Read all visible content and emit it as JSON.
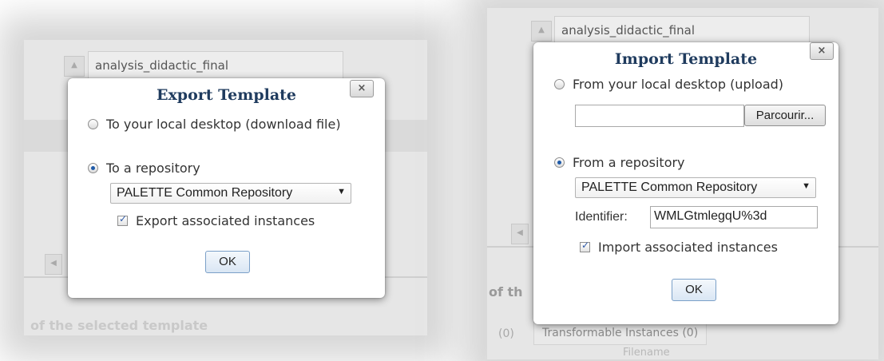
{
  "background": {
    "tab_title": "analysis_didactic_final",
    "scroll_up_glyph": "▲",
    "scroll_left_glyph": "◀",
    "left_footer_text": "of the selected template",
    "right_faded_text": "of th",
    "right_bottom_counter": "(0)",
    "right_bottom_tab": "Transformable Instances (0)",
    "right_bottom_column": "Filename"
  },
  "export_dialog": {
    "title": "Export Template",
    "close_glyph": "×",
    "option_local": "To your local desktop (download file)",
    "option_repo": "To a repository",
    "selected_option": "repository",
    "repository_select": "PALETTE Common Repository",
    "caret_glyph": "▼",
    "checkbox_label": "Export associated instances",
    "checkbox_checked": true,
    "ok_label": "OK"
  },
  "import_dialog": {
    "title": "Import Template",
    "close_glyph": "×",
    "option_local": "From your local desktop (upload)",
    "file_value": "",
    "browse_label": "Parcourir...",
    "option_repo": "From a repository",
    "selected_option": "repository",
    "repository_select": "PALETTE Common Repository",
    "caret_glyph": "▼",
    "identifier_label": "Identifier:",
    "identifier_value": "WMLGtmlegqU%3d",
    "checkbox_label": "Import associated instances",
    "checkbox_checked": true,
    "ok_label": "OK"
  },
  "colors": {
    "title": "#1f3b5e",
    "radio_selected": "#1e5aa8",
    "ok_border": "#7ba0c8"
  }
}
